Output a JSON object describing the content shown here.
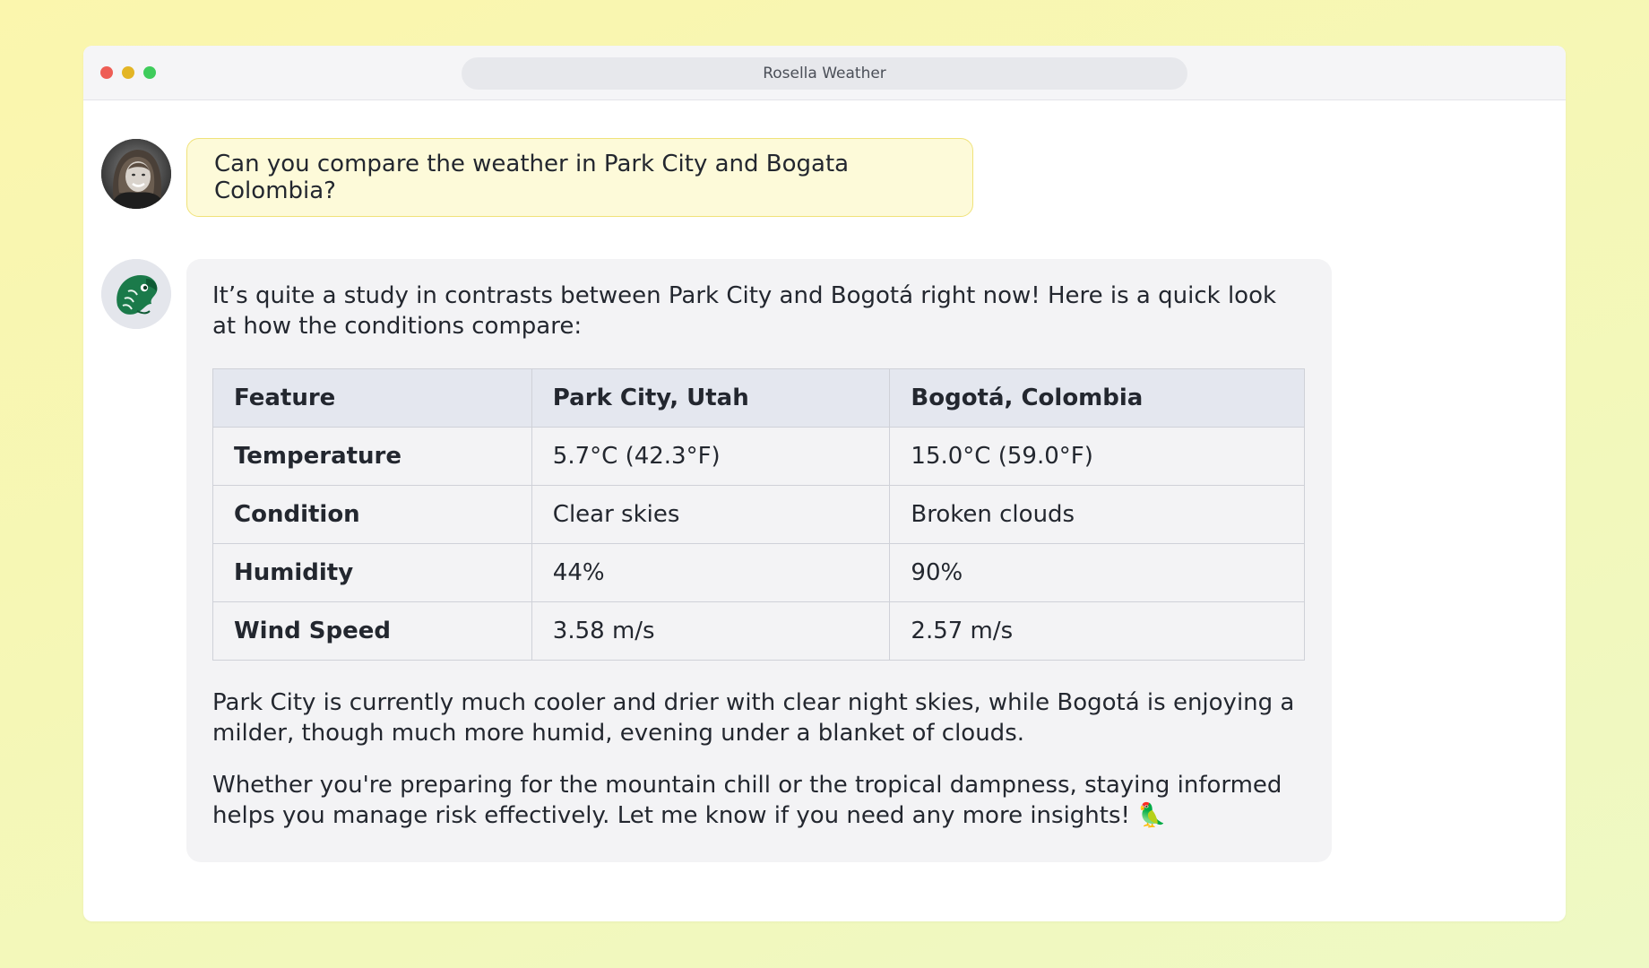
{
  "window": {
    "title": "Rosella Weather",
    "controls": [
      "close",
      "minimize",
      "maximize"
    ]
  },
  "user_message": {
    "avatar": "user-avatar-photo",
    "text": "Can you compare the weather in Park City and Bogata Colombia?"
  },
  "assistant_message": {
    "avatar": "parrot-head-icon",
    "intro": "It’s quite a study in contrasts between Park City and Bogotá right now! Here is a quick look at how the conditions compare:",
    "table": {
      "headers": [
        "Feature",
        "Park City, Utah",
        "Bogotá, Colombia"
      ],
      "rows": [
        [
          "Temperature",
          "5.7°C (42.3°F)",
          "15.0°C (59.0°F)"
        ],
        [
          "Condition",
          "Clear skies",
          "Broken clouds"
        ],
        [
          "Humidity",
          "44%",
          "90%"
        ],
        [
          "Wind Speed",
          "3.58 m/s",
          "2.57 m/s"
        ]
      ]
    },
    "paragraph1": "Park City is currently much cooler and drier with clear night skies, while Bogotá is enjoying a milder, though much more humid, evening under a blanket of clouds.",
    "paragraph2": "Whether you're preparing for the mountain chill or the tropical dampness, staying informed helps you manage risk effectively. Let me know if you need any more insights! 🦜"
  },
  "colors": {
    "background_gradient": [
      "#fbf6ad",
      "#eef9c4"
    ],
    "user_bubble_bg": "#fdfad9",
    "user_bubble_border": "#f0e27a",
    "assistant_bubble_bg": "#f3f3f5",
    "table_header_bg": "#e4e7ef",
    "bot_avatar_green": "#1b7a4a"
  }
}
